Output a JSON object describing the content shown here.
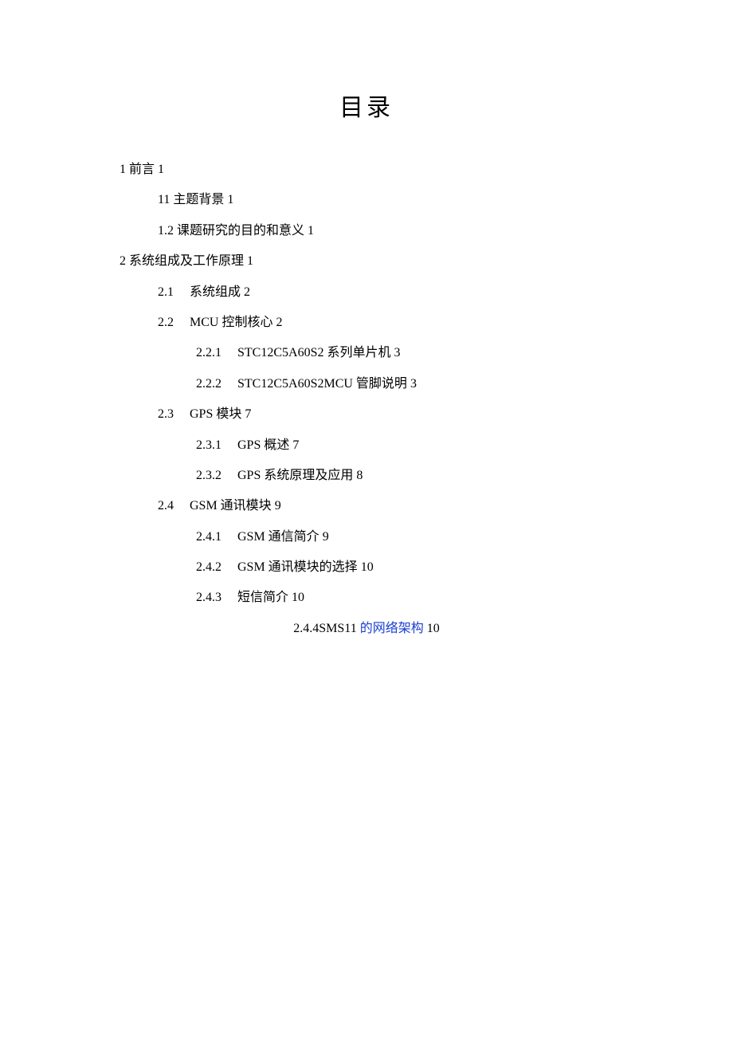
{
  "title": "目录",
  "toc": {
    "s1": {
      "num": "1",
      "label": "前言",
      "page": "1",
      "c1": {
        "num": "11",
        "label": "主题背景",
        "page": "1"
      },
      "c2": {
        "num": "1.2",
        "label": "课题研究的目的和意义",
        "page": "1"
      }
    },
    "s2": {
      "num": "2",
      "label": "系统组成及工作原理",
      "page": "1",
      "c1": {
        "num": "2.1",
        "label": "系统组成",
        "page": "2"
      },
      "c2": {
        "num": "2.2",
        "label": "MCU 控制核心",
        "page": "2",
        "d1": {
          "num": "2.2.1",
          "label": "STC12C5A60S2 系列单片机",
          "page": "3"
        },
        "d2": {
          "num": "2.2.2",
          "label": "STC12C5A60S2MCU 管脚说明",
          "page": "3"
        }
      },
      "c3": {
        "num": "2.3",
        "label": "GPS 模块",
        "page": "7",
        "d1": {
          "num": "2.3.1",
          "label": "GPS 概述",
          "page": "7"
        },
        "d2": {
          "num": "2.3.2",
          "label": "GPS 系统原理及应用",
          "page": "8"
        }
      },
      "c4": {
        "num": "2.4",
        "label": "GSM 通讯模块",
        "page": "9",
        "d1": {
          "num": "2.4.1",
          "label": "GSM 通信简介",
          "page": "9"
        },
        "d2": {
          "num": "2.4.2",
          "label": "GSM 通讯模块的选择",
          "page": "10"
        },
        "d3": {
          "num": "2.4.3",
          "label": "短信简介",
          "page": "10"
        },
        "d4": {
          "num": "2.4.4SMS11",
          "label_link": "的网络架构",
          "page": "10"
        }
      }
    }
  }
}
